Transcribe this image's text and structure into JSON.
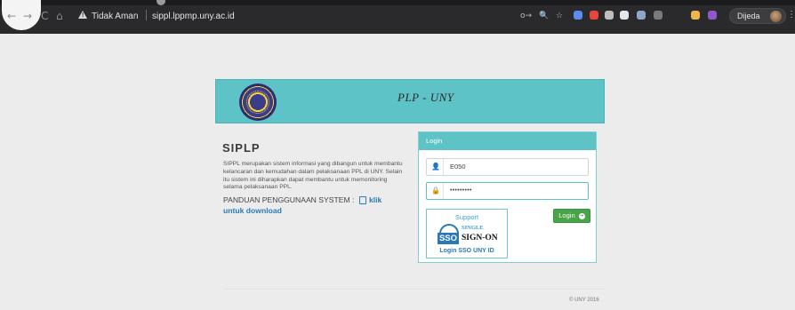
{
  "browser": {
    "security_label": "Tidak Aman",
    "url": "sippl.lppmp.uny.ac.id",
    "profile_name": "Dijeda",
    "nav": {
      "back": "←",
      "forward": "→",
      "reload": "C",
      "home": "⌂"
    },
    "omnibox_icons": {
      "key": "o→",
      "search": "🔍",
      "star": "☆"
    },
    "extension_colors": [
      "#5b8def",
      "#e8453c",
      "#bfbfbf",
      "#e6e6e6",
      "#8fa6c9",
      "#7a7a7a",
      "#f0b44c",
      "#8d58c9"
    ],
    "menu": "⋮"
  },
  "banner": {
    "title": "PLP - UNY"
  },
  "info": {
    "title": "SIPLP",
    "description": "SIPPL merupakan sistem informasi yang dibangun untuk membantu kelancaran dan kemudahan dalam pelaksanaan PPL di UNY. Selain itu sistem ini diharapkan dapat membantu untuk memonitoring selama pelaksanaan PPL.",
    "manual_label": "PANDUAN PENGGUNAAN SYSTEM :",
    "manual_link_1": "klik",
    "manual_link_2": "untuk download"
  },
  "login": {
    "header": "Login",
    "username_icon": "👤",
    "username_value": "E050",
    "password_icon": "🔒",
    "password_value": "•••••••••",
    "button_label": "Login",
    "button_icon": "➔",
    "sso": {
      "support": "Support",
      "badge": "SSO",
      "single": "SINGLE",
      "sign_on": "SIGN-ON",
      "link": "Login SSO UNY ID"
    }
  },
  "footer": {
    "text": "© UNY 2016"
  },
  "colors": {
    "teal": "#5ec3c6",
    "link": "#2b7bb5",
    "button": "#47a447"
  }
}
